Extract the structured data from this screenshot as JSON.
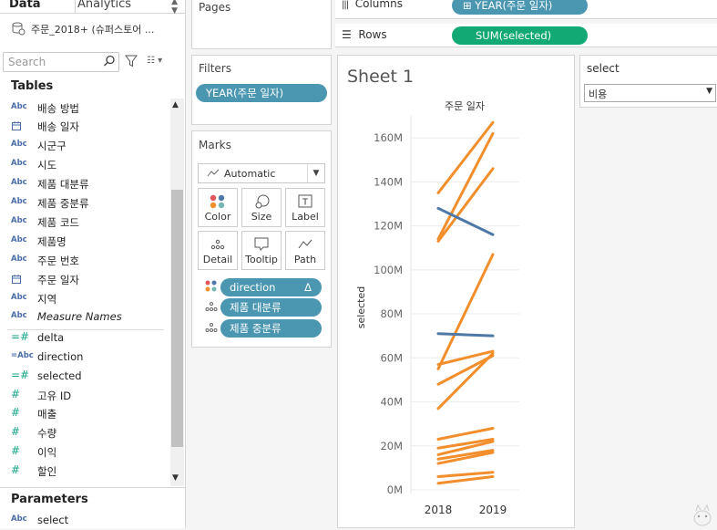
{
  "left_panel": {
    "tabs": {
      "data": "Data",
      "analytics": "Analytics"
    },
    "datasource": "주문_2018+ (슈퍼스토어 ...",
    "search_placeholder": "Search",
    "tables_header": "Tables",
    "fields": [
      {
        "icon": "Abc",
        "name": "배송 방법",
        "kind": "dim"
      },
      {
        "icon": "cal",
        "name": "배송 일자",
        "kind": "date"
      },
      {
        "icon": "Abc",
        "name": "시군구",
        "kind": "dim"
      },
      {
        "icon": "Abc",
        "name": "시도",
        "kind": "dim"
      },
      {
        "icon": "Abc",
        "name": "제품 대분류",
        "kind": "dim"
      },
      {
        "icon": "Abc",
        "name": "제품 중분류",
        "kind": "dim"
      },
      {
        "icon": "Abc",
        "name": "제품 코드",
        "kind": "dim"
      },
      {
        "icon": "Abc",
        "name": "제품명",
        "kind": "dim"
      },
      {
        "icon": "Abc",
        "name": "주문 번호",
        "kind": "dim"
      },
      {
        "icon": "cal",
        "name": "주문 일자",
        "kind": "date"
      },
      {
        "icon": "Abc",
        "name": "지역",
        "kind": "dim"
      },
      {
        "icon": "Abc",
        "name": "Measure Names",
        "kind": "dim-italic"
      },
      {
        "icon": "=#",
        "name": "delta",
        "kind": "measure"
      },
      {
        "icon": "=Abc",
        "name": "direction",
        "kind": "calc-dim"
      },
      {
        "icon": "=#",
        "name": "selected",
        "kind": "measure"
      },
      {
        "icon": "#",
        "name": "고유 ID",
        "kind": "measure"
      },
      {
        "icon": "#",
        "name": "매출",
        "kind": "measure"
      },
      {
        "icon": "#",
        "name": "수량",
        "kind": "measure"
      },
      {
        "icon": "#",
        "name": "이익",
        "kind": "measure"
      },
      {
        "icon": "#",
        "name": "할인",
        "kind": "measure"
      }
    ],
    "parameters_header": "Parameters",
    "parameters": [
      {
        "icon": "Abc",
        "name": "select"
      }
    ]
  },
  "pages": {
    "title": "Pages"
  },
  "filters": {
    "title": "Filters",
    "pills": [
      "YEAR(주문 일자)"
    ]
  },
  "marks": {
    "title": "Marks",
    "mark_type": "Automatic",
    "buttons": [
      "Color",
      "Size",
      "Label",
      "Detail",
      "Tooltip",
      "Path"
    ],
    "pills": [
      {
        "label": "direction",
        "icon": "color",
        "badge": "Δ"
      },
      {
        "label": "제품 대분류",
        "icon": "detail"
      },
      {
        "label": "제품 중분류",
        "icon": "detail"
      }
    ]
  },
  "shelves": {
    "columns_label": "Columns",
    "columns_pill": "YEAR(주문 일자)",
    "rows_label": "Rows",
    "rows_pill": "SUM(selected)"
  },
  "sheet": {
    "title": "Sheet 1"
  },
  "parameter_control": {
    "title": "select",
    "value": "비용"
  },
  "colors": {
    "orange": "#f28e2b",
    "blue": "#4e79a7",
    "pill_blue": "#4b97b2",
    "pill_green": "#12a975"
  },
  "chart_data": {
    "type": "line",
    "title": "주문 일자",
    "xlabel": "",
    "ylabel": "selected",
    "categories": [
      "2018",
      "2019"
    ],
    "ylim": [
      0,
      170
    ],
    "yticks": [
      "0M",
      "20M",
      "40M",
      "60M",
      "80M",
      "100M",
      "120M",
      "140M",
      "160M"
    ],
    "ytick_values": [
      0,
      20,
      40,
      60,
      80,
      100,
      120,
      140,
      160
    ],
    "series": [
      {
        "direction": "up",
        "values": [
          135,
          167
        ]
      },
      {
        "direction": "up",
        "values": [
          114,
          162
        ]
      },
      {
        "direction": "up",
        "values": [
          113,
          146
        ]
      },
      {
        "direction": "down",
        "values": [
          128,
          116
        ]
      },
      {
        "direction": "up",
        "values": [
          55,
          107
        ]
      },
      {
        "direction": "down",
        "values": [
          71,
          70
        ]
      },
      {
        "direction": "up",
        "values": [
          57,
          63
        ]
      },
      {
        "direction": "up",
        "values": [
          48,
          61
        ]
      },
      {
        "direction": "up",
        "values": [
          37,
          62
        ]
      },
      {
        "direction": "up",
        "values": [
          23,
          28
        ]
      },
      {
        "direction": "up",
        "values": [
          19,
          23
        ]
      },
      {
        "direction": "up",
        "values": [
          16,
          22
        ]
      },
      {
        "direction": "up",
        "values": [
          14,
          18
        ]
      },
      {
        "direction": "up",
        "values": [
          12,
          17
        ]
      },
      {
        "direction": "up",
        "values": [
          6,
          8
        ]
      },
      {
        "direction": "up",
        "values": [
          3,
          6
        ]
      }
    ]
  }
}
